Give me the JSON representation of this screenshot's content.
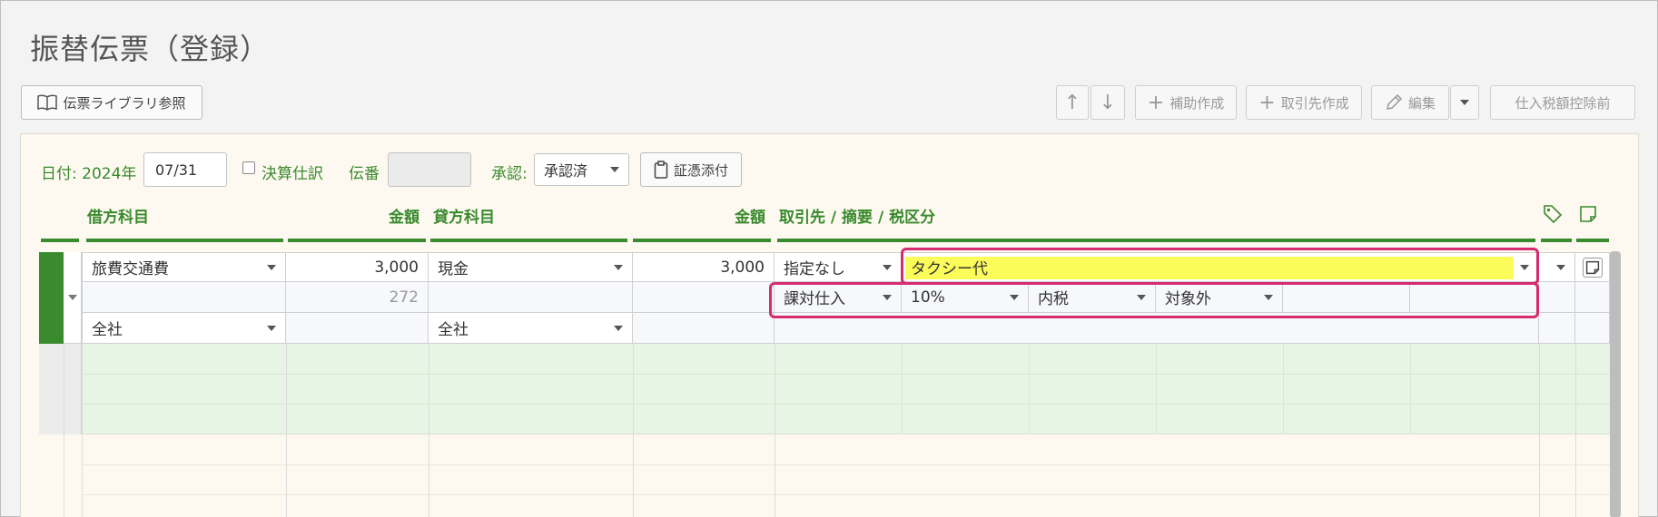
{
  "page": {
    "title": "振替伝票（登録）"
  },
  "toolbar": {
    "library_button": "伝票ライブラリ参照",
    "up_arrow": "↑",
    "down_arrow": "↓",
    "add_sub_button": "補助作成",
    "add_partner_button": "取引先作成",
    "edit_button": "編集",
    "tax_button": "仕入税額控除前"
  },
  "form": {
    "date_label": "日付: 2024年",
    "date_value": "07/31",
    "closing_label": "決算仕訳",
    "slip_no_label": "伝番",
    "slip_no_value": "",
    "approval_label": "承認:",
    "approval_value": "承認済",
    "attach_button": "証憑添付"
  },
  "columns": {
    "debit_account": "借方科目",
    "debit_amount": "金額",
    "credit_account": "貸方科目",
    "credit_amount": "金額",
    "partner_memo_tax": "取引先 / 摘要 / 税区分"
  },
  "entry": {
    "debit_account": "旅費交通費",
    "debit_amount": "3,000",
    "debit_tax_amount": "272",
    "debit_department": "全社",
    "credit_account": "現金",
    "credit_amount": "3,000",
    "credit_department": "全社",
    "partner": "指定なし",
    "memo": "タクシー代",
    "tax_category": "課対仕入",
    "tax_rate": "10%",
    "tax_inclusion": "内税",
    "tax_scope": "対象外"
  },
  "colors": {
    "accent_green": "#3a8a2e",
    "highlight_pink": "#d62b6f",
    "memo_yellow": "#fbfb5a"
  }
}
